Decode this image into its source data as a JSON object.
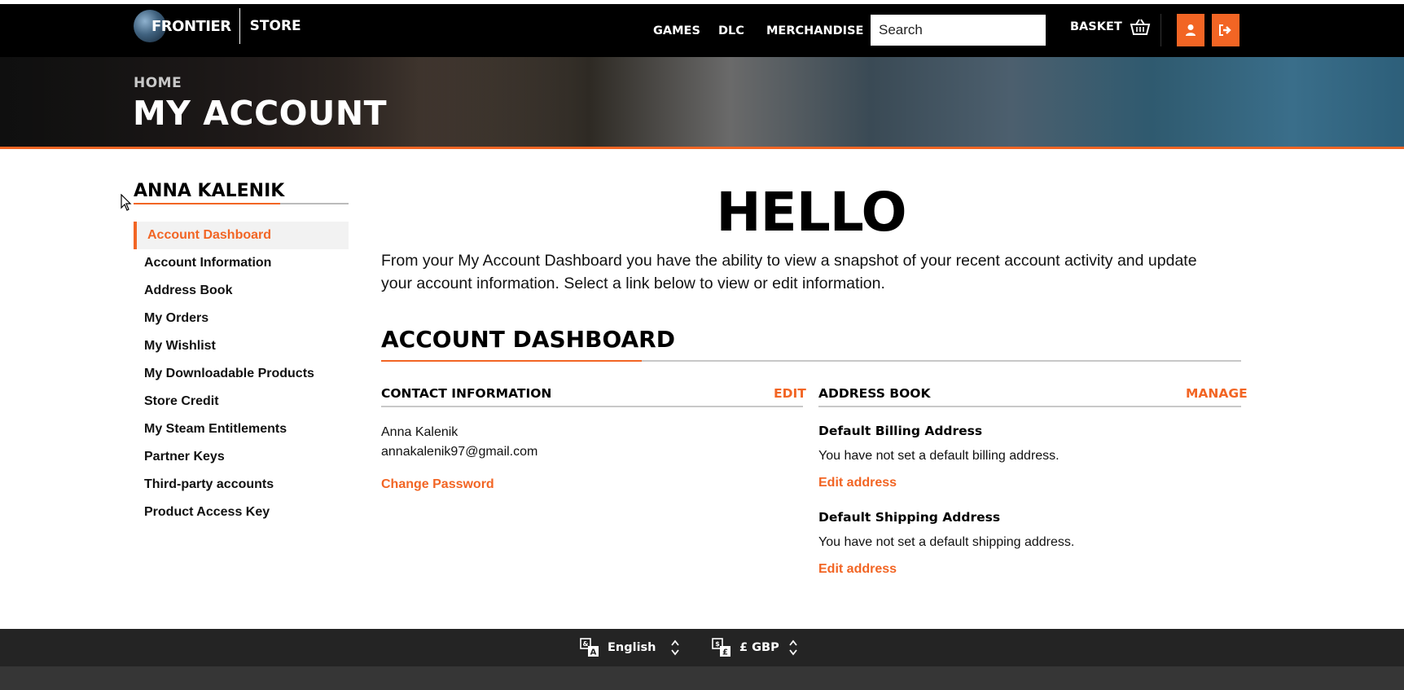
{
  "header": {
    "logo_text": "FRONTIER",
    "store_text": "STORE",
    "nav": [
      "GAMES",
      "DLC",
      "MERCHANDISE"
    ],
    "search_placeholder": "Search",
    "basket_label": "BASKET"
  },
  "banner": {
    "breadcrumb": "HOME",
    "title": "MY ACCOUNT"
  },
  "sidebar": {
    "user_name": "ANNA KALENIK",
    "items": [
      {
        "label": "Account Dashboard",
        "active": true
      },
      {
        "label": "Account Information"
      },
      {
        "label": "Address Book"
      },
      {
        "label": "My Orders"
      },
      {
        "label": "My Wishlist"
      },
      {
        "label": "My Downloadable Products"
      },
      {
        "label": "Store Credit"
      },
      {
        "label": "My Steam Entitlements"
      },
      {
        "label": "Partner Keys"
      },
      {
        "label": "Third-party accounts"
      },
      {
        "label": "Product Access Key"
      }
    ]
  },
  "main": {
    "hello": "HELLO",
    "intro": "From your My Account Dashboard you have the ability to view a snapshot of your recent account activity and update your account information. Select a link below to view or edit information.",
    "dashboard_title": "ACCOUNT DASHBOARD",
    "contact": {
      "title": "CONTACT INFORMATION",
      "edit_label": "EDIT",
      "name": "Anna Kalenik",
      "email": "annakalenik97@gmail.com",
      "change_password": "Change Password"
    },
    "address_book": {
      "title": "ADDRESS BOOK",
      "manage_label": "MANAGE",
      "billing_title": "Default Billing Address",
      "billing_text": "You have not set a default billing address.",
      "billing_edit": "Edit address",
      "shipping_title": "Default Shipping Address",
      "shipping_text": "You have not set a default shipping address.",
      "shipping_edit": "Edit address"
    }
  },
  "footer": {
    "language": "English",
    "currency": "£ GBP"
  },
  "colors": {
    "accent": "#f26524",
    "header_bg": "#000000",
    "footer_bg": "#242424"
  },
  "icons": [
    "globe-logo-icon",
    "basket-icon",
    "user-icon",
    "logout-icon",
    "language-icon",
    "currency-icon",
    "select-arrows-icon",
    "mouse-cursor-icon"
  ]
}
